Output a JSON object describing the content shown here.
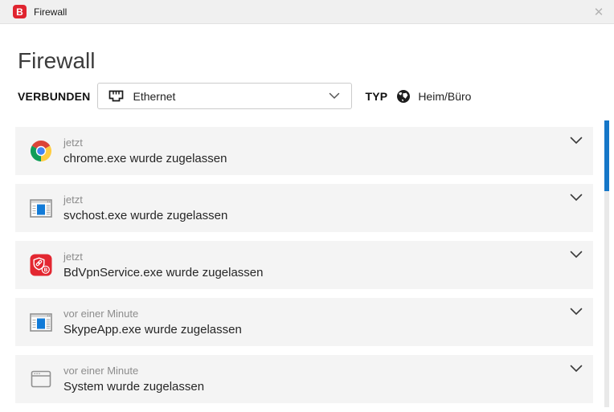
{
  "titlebar": {
    "app_initial": "B",
    "title": "Firewall",
    "close_glyph": "✕"
  },
  "main": {
    "heading": "Firewall"
  },
  "connection": {
    "connected_label": "VERBUNDEN",
    "network_name": "Ethernet",
    "type_label": "TYP",
    "type_value": "Heim/Büro"
  },
  "events": [
    {
      "icon": "chrome-icon",
      "time": "jetzt",
      "message": "chrome.exe wurde zugelassen"
    },
    {
      "icon": "windows-exe-icon",
      "time": "jetzt",
      "message": "svchost.exe wurde zugelassen"
    },
    {
      "icon": "bitdefender-vpn-icon",
      "time": "jetzt",
      "message": "BdVpnService.exe wurde zugelassen"
    },
    {
      "icon": "windows-exe-icon",
      "time": "vor einer Minute",
      "message": "SkypeApp.exe wurde zugelassen"
    },
    {
      "icon": "system-window-icon",
      "time": "vor einer Minute",
      "message": "System wurde zugelassen"
    }
  ],
  "colors": {
    "brand_red": "#e0242f",
    "accent_blue": "#1677c8",
    "row_background": "#f4f4f4"
  }
}
